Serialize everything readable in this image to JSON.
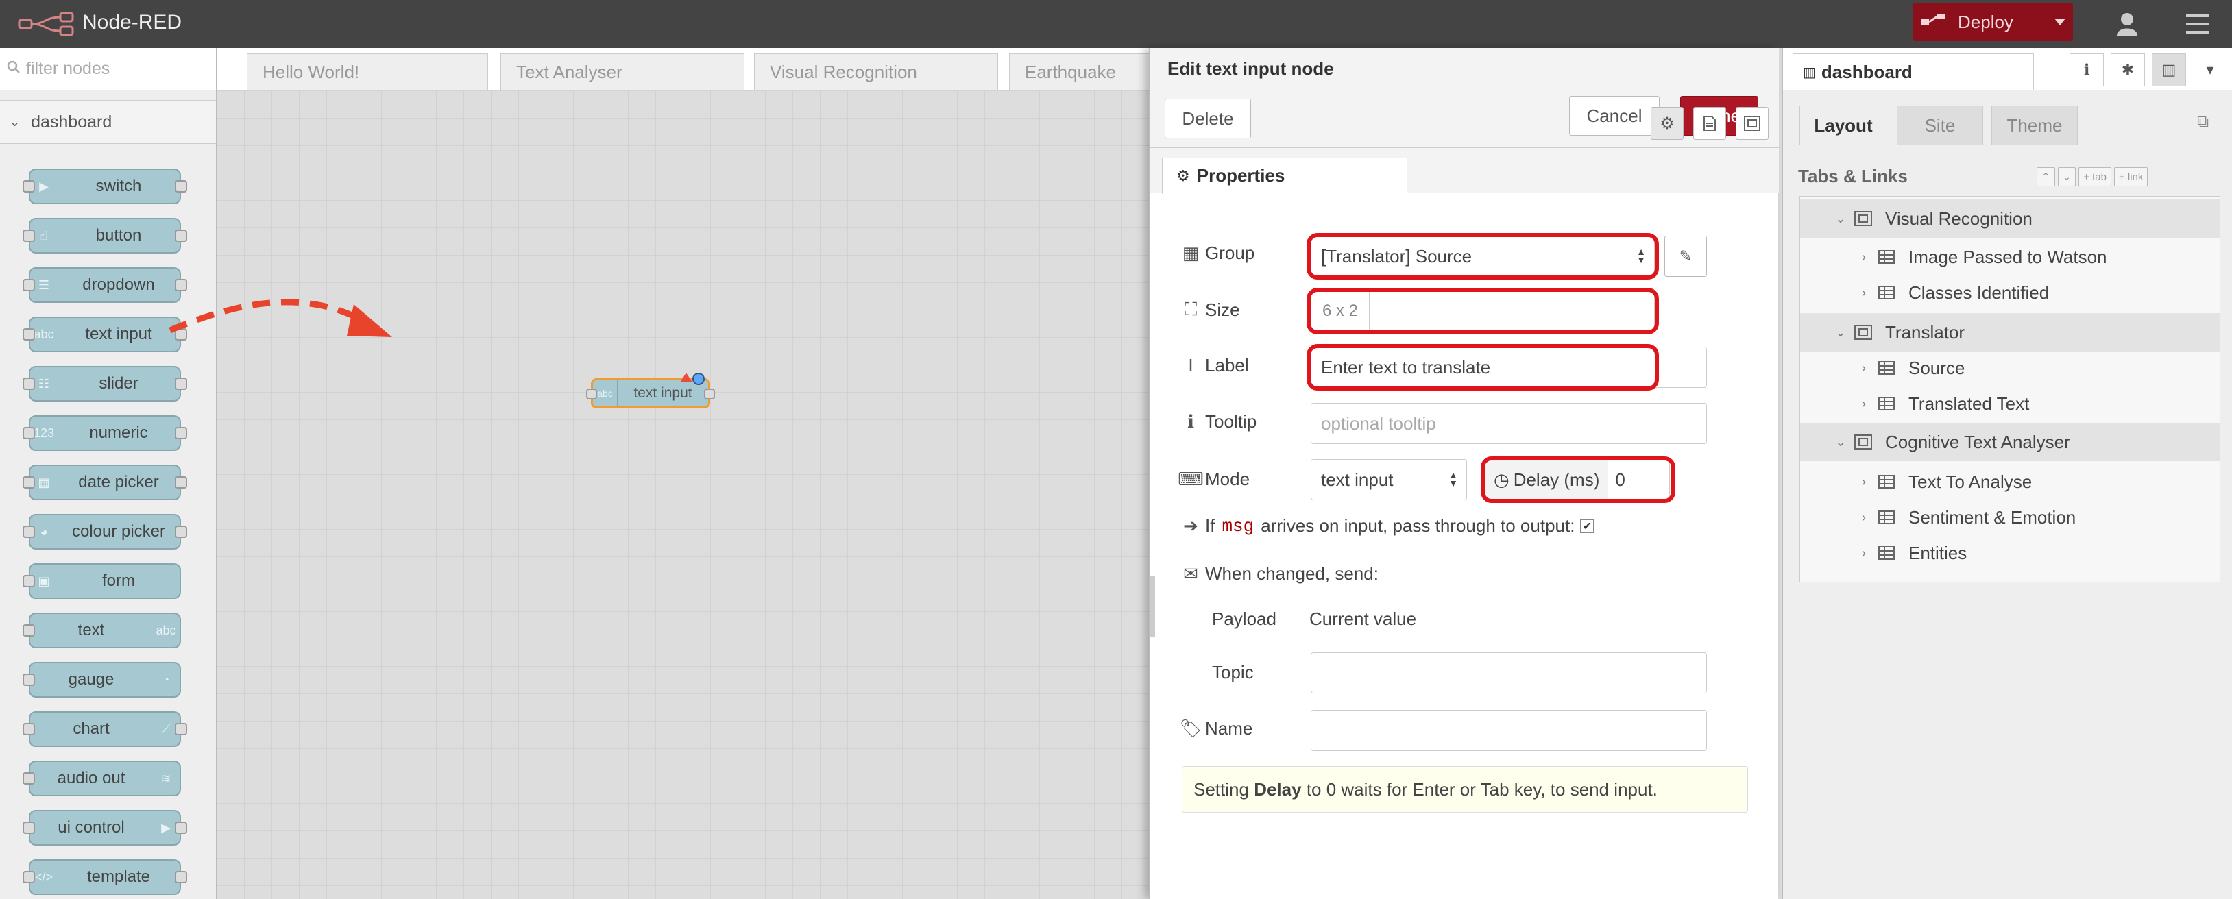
{
  "header": {
    "brand": "Node-RED",
    "deploy_label": "Deploy"
  },
  "palette": {
    "filter_placeholder": "filter nodes",
    "category": "dashboard",
    "nodes": [
      "switch",
      "button",
      "dropdown",
      "text input",
      "slider",
      "numeric",
      "date picker",
      "colour picker",
      "form",
      "text",
      "gauge",
      "chart",
      "audio out",
      "ui control",
      "template"
    ]
  },
  "workspace": {
    "tabs": [
      "Hello World!",
      "Text Analyser",
      "Visual Recognition",
      "Earthquake"
    ],
    "flow_node_label": "text input"
  },
  "tray": {
    "title": "Edit text input node",
    "delete_label": "Delete",
    "cancel_label": "Cancel",
    "done_label": "Done",
    "properties_tab": "Properties",
    "group_label": "Group",
    "group_value": "[Translator] Source",
    "size_label": "Size",
    "size_value": "6 x 2",
    "label_label": "Label",
    "label_value": "Enter text to translate",
    "tooltip_label": "Tooltip",
    "tooltip_placeholder": "optional tooltip",
    "mode_label": "Mode",
    "mode_value": "text input",
    "delay_label": "Delay (ms)",
    "delay_value": "0",
    "passthrough_prefix": "If",
    "passthrough_msg": "msg",
    "passthrough_suffix": "arrives on input, pass through to output:",
    "passthrough_checked": true,
    "when_changed": "When changed, send:",
    "payload_label": "Payload",
    "payload_value": "Current value",
    "topic_label": "Topic",
    "topic_value": "",
    "name_label": "Name",
    "name_value": "",
    "tip_prefix": "Setting",
    "tip_bold": "Delay",
    "tip_suffix": "to 0 waits for Enter or Tab key, to send input."
  },
  "sidebar": {
    "tab_label": "dashboard",
    "subtabs": [
      "Layout",
      "Site",
      "Theme"
    ],
    "tabs_links": "Tabs & Links",
    "tool_buttons": [
      "tab",
      "link"
    ],
    "tree": [
      {
        "label": "Visual Recognition",
        "kind": "tab"
      },
      {
        "label": "Image Passed to Watson",
        "kind": "group"
      },
      {
        "label": "Classes Identified",
        "kind": "group"
      },
      {
        "label": "Translator",
        "kind": "tab"
      },
      {
        "label": "Source",
        "kind": "group"
      },
      {
        "label": "Translated Text",
        "kind": "group"
      },
      {
        "label": "Cognitive Text Analyser",
        "kind": "tab"
      },
      {
        "label": "Text To Analyse",
        "kind": "group"
      },
      {
        "label": "Sentiment & Emotion",
        "kind": "group"
      },
      {
        "label": "Entities",
        "kind": "group"
      }
    ]
  },
  "colors": {
    "header": "#444444",
    "deploy": "#8c101c",
    "done": "#ad1625",
    "highlight": "#e0151c",
    "node": "#a6c9d1",
    "arrow": "#e8442c"
  }
}
